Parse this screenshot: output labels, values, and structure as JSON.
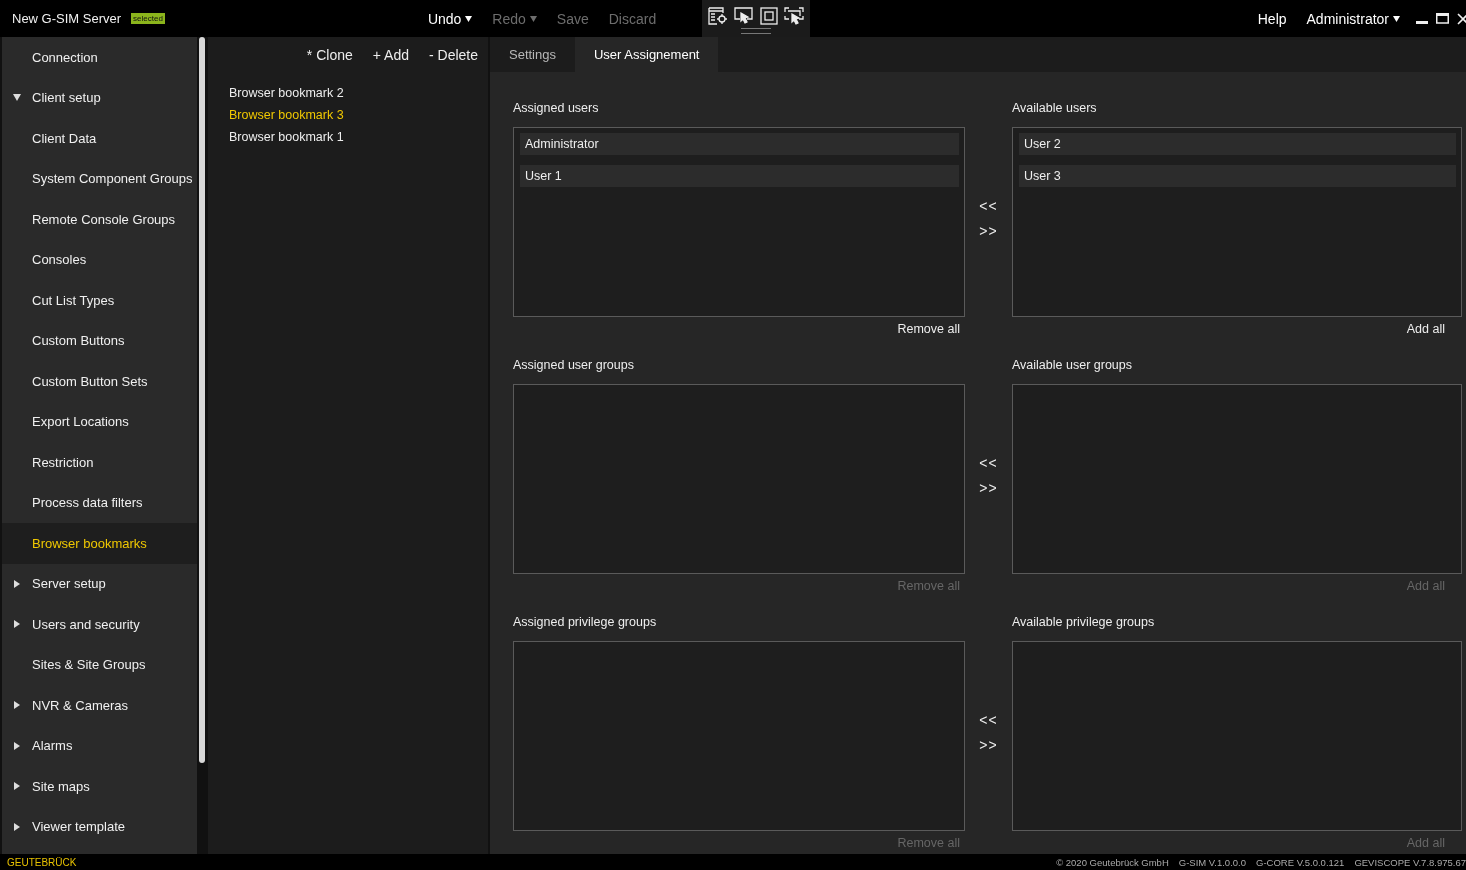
{
  "window": {
    "title": "New G-SIM Server",
    "badge": "selected"
  },
  "toolbar": {
    "actions": [
      {
        "label": "Undo",
        "menu": true,
        "disabled": false
      },
      {
        "label": "Redo",
        "menu": true,
        "disabled": true
      },
      {
        "label": "Save",
        "menu": false,
        "disabled": true
      },
      {
        "label": "Discard",
        "menu": false,
        "disabled": true
      }
    ]
  },
  "header_links": [
    {
      "label": "Help",
      "menu": false
    },
    {
      "label": "Administrator",
      "menu": true
    }
  ],
  "sidebar": {
    "items": [
      {
        "label": "Connection",
        "selected": false
      },
      {
        "label": "Client setup",
        "expanded": true,
        "selected": false,
        "children": [
          {
            "label": "Client Data",
            "selected": false
          },
          {
            "label": "System Component Groups",
            "selected": false
          },
          {
            "label": "Remote Console Groups",
            "selected": false
          },
          {
            "label": "Consoles",
            "selected": false
          },
          {
            "label": "Cut List Types",
            "selected": false
          },
          {
            "label": "Custom Buttons",
            "selected": false
          },
          {
            "label": "Custom Button Sets",
            "selected": false
          },
          {
            "label": "Export Locations",
            "selected": false
          },
          {
            "label": "Restriction",
            "selected": false
          },
          {
            "label": "Process data filters",
            "selected": false
          },
          {
            "label": "Browser bookmarks",
            "selected": true
          }
        ]
      },
      {
        "label": "Server setup",
        "expanded": false,
        "selected": false
      },
      {
        "label": "Users and security",
        "expanded": false,
        "selected": false
      },
      {
        "label": "Sites & Site Groups",
        "selected": false
      },
      {
        "label": "NVR & Cameras",
        "expanded": false,
        "selected": false
      },
      {
        "label": "Alarms",
        "expanded": false,
        "selected": false
      },
      {
        "label": "Site maps",
        "expanded": false,
        "selected": false
      },
      {
        "label": "Viewer template",
        "expanded": false,
        "selected": false
      }
    ]
  },
  "list_actions": [
    "* Clone",
    "+ Add",
    "- Delete"
  ],
  "bookmarks": [
    {
      "label": "Browser bookmark 2",
      "selected": false
    },
    {
      "label": "Browser bookmark 3",
      "selected": true
    },
    {
      "label": "Browser bookmark 1",
      "selected": false
    }
  ],
  "tabs": [
    {
      "label": "Settings",
      "selected": false
    },
    {
      "label": "User Assignement",
      "selected": true
    }
  ],
  "sections": [
    {
      "assigned": {
        "label": "Assigned users",
        "items": [
          "Administrator",
          "User 1"
        ],
        "action": {
          "label": "Remove all",
          "disabled": false
        }
      },
      "transfer": [
        "<<",
        ">>"
      ],
      "available": {
        "label": "Available users",
        "items": [
          "User 2",
          "User 3"
        ],
        "action": {
          "label": "Add all",
          "disabled": false
        }
      }
    },
    {
      "assigned": {
        "label": "Assigned user groups",
        "action": {
          "label": "Remove all",
          "disabled": true
        }
      },
      "transfer": [
        "<<",
        ">>"
      ],
      "available": {
        "label": "Available user groups",
        "action": {
          "label": "Add all",
          "disabled": true
        }
      }
    },
    {
      "assigned": {
        "label": "Assigned privilege groups",
        "action": {
          "label": "Remove all",
          "disabled": true
        }
      },
      "transfer": [
        "<<",
        ">>"
      ],
      "available": {
        "label": "Available privilege groups",
        "action": {
          "label": "Add all",
          "disabled": true
        }
      }
    }
  ],
  "footer": {
    "brand": "GEUTEBRÜCK",
    "info": [
      "© 2020 Geutebrück GmbH",
      "G-SIM V.1.0.0.0",
      "G-CORE V.5.0.0.121",
      "GEVISCOPE V.7.8.975.67"
    ]
  }
}
